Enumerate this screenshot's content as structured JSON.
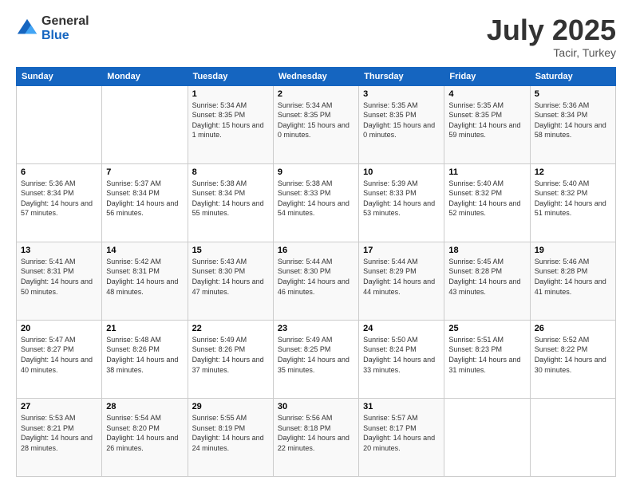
{
  "logo": {
    "general": "General",
    "blue": "Blue"
  },
  "title": "July 2025",
  "subtitle": "Tacir, Turkey",
  "days_of_week": [
    "Sunday",
    "Monday",
    "Tuesday",
    "Wednesday",
    "Thursday",
    "Friday",
    "Saturday"
  ],
  "weeks": [
    [
      {
        "day": "",
        "sunrise": "",
        "sunset": "",
        "daylight": ""
      },
      {
        "day": "",
        "sunrise": "",
        "sunset": "",
        "daylight": ""
      },
      {
        "day": "1",
        "sunrise": "Sunrise: 5:34 AM",
        "sunset": "Sunset: 8:35 PM",
        "daylight": "Daylight: 15 hours and 1 minute."
      },
      {
        "day": "2",
        "sunrise": "Sunrise: 5:34 AM",
        "sunset": "Sunset: 8:35 PM",
        "daylight": "Daylight: 15 hours and 0 minutes."
      },
      {
        "day": "3",
        "sunrise": "Sunrise: 5:35 AM",
        "sunset": "Sunset: 8:35 PM",
        "daylight": "Daylight: 15 hours and 0 minutes."
      },
      {
        "day": "4",
        "sunrise": "Sunrise: 5:35 AM",
        "sunset": "Sunset: 8:35 PM",
        "daylight": "Daylight: 14 hours and 59 minutes."
      },
      {
        "day": "5",
        "sunrise": "Sunrise: 5:36 AM",
        "sunset": "Sunset: 8:34 PM",
        "daylight": "Daylight: 14 hours and 58 minutes."
      }
    ],
    [
      {
        "day": "6",
        "sunrise": "Sunrise: 5:36 AM",
        "sunset": "Sunset: 8:34 PM",
        "daylight": "Daylight: 14 hours and 57 minutes."
      },
      {
        "day": "7",
        "sunrise": "Sunrise: 5:37 AM",
        "sunset": "Sunset: 8:34 PM",
        "daylight": "Daylight: 14 hours and 56 minutes."
      },
      {
        "day": "8",
        "sunrise": "Sunrise: 5:38 AM",
        "sunset": "Sunset: 8:34 PM",
        "daylight": "Daylight: 14 hours and 55 minutes."
      },
      {
        "day": "9",
        "sunrise": "Sunrise: 5:38 AM",
        "sunset": "Sunset: 8:33 PM",
        "daylight": "Daylight: 14 hours and 54 minutes."
      },
      {
        "day": "10",
        "sunrise": "Sunrise: 5:39 AM",
        "sunset": "Sunset: 8:33 PM",
        "daylight": "Daylight: 14 hours and 53 minutes."
      },
      {
        "day": "11",
        "sunrise": "Sunrise: 5:40 AM",
        "sunset": "Sunset: 8:32 PM",
        "daylight": "Daylight: 14 hours and 52 minutes."
      },
      {
        "day": "12",
        "sunrise": "Sunrise: 5:40 AM",
        "sunset": "Sunset: 8:32 PM",
        "daylight": "Daylight: 14 hours and 51 minutes."
      }
    ],
    [
      {
        "day": "13",
        "sunrise": "Sunrise: 5:41 AM",
        "sunset": "Sunset: 8:31 PM",
        "daylight": "Daylight: 14 hours and 50 minutes."
      },
      {
        "day": "14",
        "sunrise": "Sunrise: 5:42 AM",
        "sunset": "Sunset: 8:31 PM",
        "daylight": "Daylight: 14 hours and 48 minutes."
      },
      {
        "day": "15",
        "sunrise": "Sunrise: 5:43 AM",
        "sunset": "Sunset: 8:30 PM",
        "daylight": "Daylight: 14 hours and 47 minutes."
      },
      {
        "day": "16",
        "sunrise": "Sunrise: 5:44 AM",
        "sunset": "Sunset: 8:30 PM",
        "daylight": "Daylight: 14 hours and 46 minutes."
      },
      {
        "day": "17",
        "sunrise": "Sunrise: 5:44 AM",
        "sunset": "Sunset: 8:29 PM",
        "daylight": "Daylight: 14 hours and 44 minutes."
      },
      {
        "day": "18",
        "sunrise": "Sunrise: 5:45 AM",
        "sunset": "Sunset: 8:28 PM",
        "daylight": "Daylight: 14 hours and 43 minutes."
      },
      {
        "day": "19",
        "sunrise": "Sunrise: 5:46 AM",
        "sunset": "Sunset: 8:28 PM",
        "daylight": "Daylight: 14 hours and 41 minutes."
      }
    ],
    [
      {
        "day": "20",
        "sunrise": "Sunrise: 5:47 AM",
        "sunset": "Sunset: 8:27 PM",
        "daylight": "Daylight: 14 hours and 40 minutes."
      },
      {
        "day": "21",
        "sunrise": "Sunrise: 5:48 AM",
        "sunset": "Sunset: 8:26 PM",
        "daylight": "Daylight: 14 hours and 38 minutes."
      },
      {
        "day": "22",
        "sunrise": "Sunrise: 5:49 AM",
        "sunset": "Sunset: 8:26 PM",
        "daylight": "Daylight: 14 hours and 37 minutes."
      },
      {
        "day": "23",
        "sunrise": "Sunrise: 5:49 AM",
        "sunset": "Sunset: 8:25 PM",
        "daylight": "Daylight: 14 hours and 35 minutes."
      },
      {
        "day": "24",
        "sunrise": "Sunrise: 5:50 AM",
        "sunset": "Sunset: 8:24 PM",
        "daylight": "Daylight: 14 hours and 33 minutes."
      },
      {
        "day": "25",
        "sunrise": "Sunrise: 5:51 AM",
        "sunset": "Sunset: 8:23 PM",
        "daylight": "Daylight: 14 hours and 31 minutes."
      },
      {
        "day": "26",
        "sunrise": "Sunrise: 5:52 AM",
        "sunset": "Sunset: 8:22 PM",
        "daylight": "Daylight: 14 hours and 30 minutes."
      }
    ],
    [
      {
        "day": "27",
        "sunrise": "Sunrise: 5:53 AM",
        "sunset": "Sunset: 8:21 PM",
        "daylight": "Daylight: 14 hours and 28 minutes."
      },
      {
        "day": "28",
        "sunrise": "Sunrise: 5:54 AM",
        "sunset": "Sunset: 8:20 PM",
        "daylight": "Daylight: 14 hours and 26 minutes."
      },
      {
        "day": "29",
        "sunrise": "Sunrise: 5:55 AM",
        "sunset": "Sunset: 8:19 PM",
        "daylight": "Daylight: 14 hours and 24 minutes."
      },
      {
        "day": "30",
        "sunrise": "Sunrise: 5:56 AM",
        "sunset": "Sunset: 8:18 PM",
        "daylight": "Daylight: 14 hours and 22 minutes."
      },
      {
        "day": "31",
        "sunrise": "Sunrise: 5:57 AM",
        "sunset": "Sunset: 8:17 PM",
        "daylight": "Daylight: 14 hours and 20 minutes."
      },
      {
        "day": "",
        "sunrise": "",
        "sunset": "",
        "daylight": ""
      },
      {
        "day": "",
        "sunrise": "",
        "sunset": "",
        "daylight": ""
      }
    ]
  ]
}
